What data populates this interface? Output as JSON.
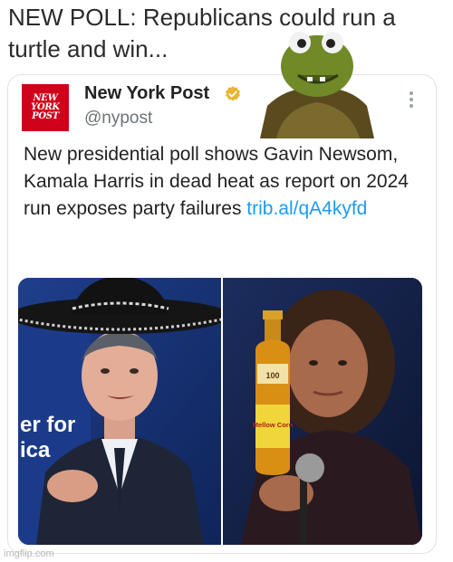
{
  "meme": {
    "caption": "NEW POLL: Republicans could run a turtle and win...",
    "watermark": "imgflip.com"
  },
  "tweet": {
    "account_name": "New York Post",
    "handle": "@nypost",
    "logo_text": "NEW\nYORK\nPOST",
    "verified": true,
    "text": "New presidential poll shows Gavin Newsom, Kamala Harris in dead heat as report on 2024 run exposes party failures ",
    "link": "trib.al/qA4kyfd",
    "photo_left": {
      "banner_text_line1": "er for",
      "banner_text_line2": "ica"
    },
    "photo_right": {
      "bottle_label": "Mellow Corn",
      "bottle_number": "100"
    }
  },
  "colors": {
    "brand_red": "#d0021b",
    "verified_gold": "#e9b431",
    "link_blue": "#1d9bf0"
  },
  "icons": [
    "verified-badge-icon",
    "more-options-icon"
  ]
}
